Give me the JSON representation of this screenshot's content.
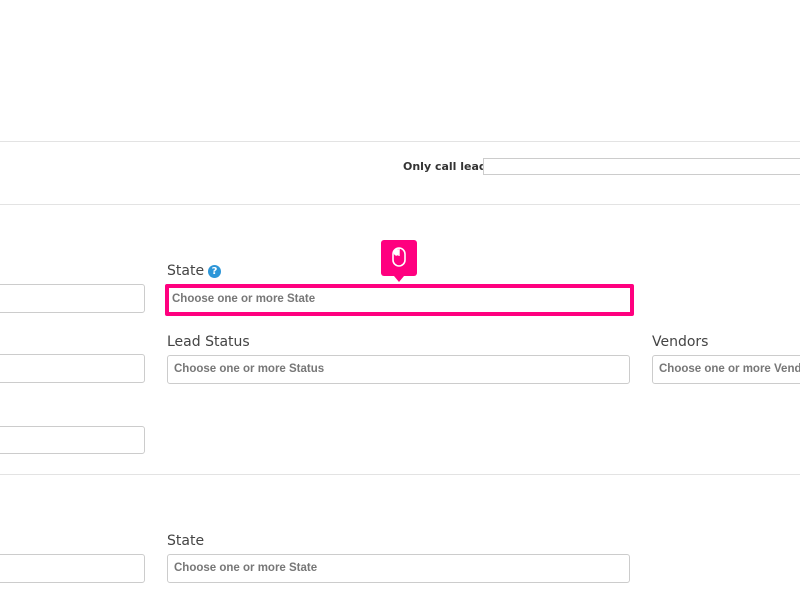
{
  "filters": {
    "only_call_leads_label": "Only call leads"
  },
  "section1": {
    "state_label": "State",
    "state_placeholder": "Choose one or more State",
    "lead_status_label": "Lead Status",
    "lead_status_placeholder": "Choose one or more Status",
    "vendors_label": "Vendors",
    "vendors_placeholder": "Choose one or more Vendors"
  },
  "section2": {
    "state_label": "State",
    "state_placeholder": "Choose one or more State"
  },
  "icons": {
    "help": "question-mark-circle",
    "cursor": "mouse-icon"
  },
  "colors": {
    "highlight": "#ff007f",
    "help_icon": "#2d96d8"
  }
}
